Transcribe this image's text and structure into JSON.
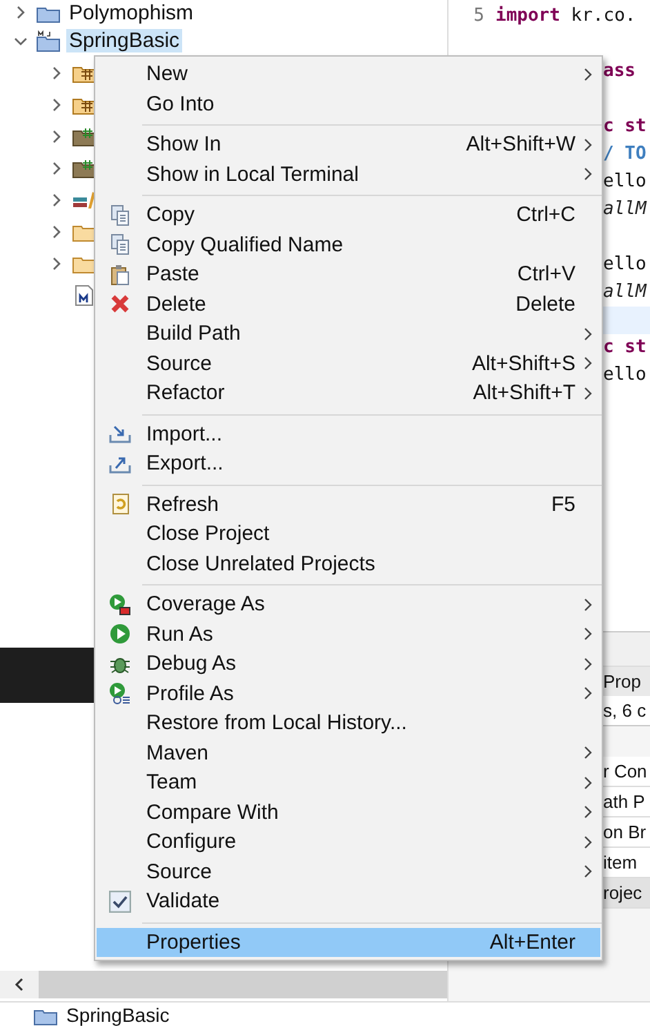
{
  "tree": {
    "items": [
      {
        "label": "Polymophism",
        "kind": "project",
        "expanded": false,
        "selected": false
      },
      {
        "label": "SpringBasic",
        "kind": "maven-project",
        "expanded": true,
        "selected": true,
        "children": [
          {
            "kind": "package-folder",
            "expanded": false
          },
          {
            "kind": "package-folder",
            "expanded": false
          },
          {
            "kind": "source-folder",
            "expanded": false
          },
          {
            "kind": "source-folder",
            "expanded": false
          },
          {
            "kind": "library",
            "expanded": false
          },
          {
            "kind": "folder",
            "expanded": false
          },
          {
            "kind": "folder",
            "expanded": false
          },
          {
            "kind": "file"
          }
        ]
      }
    ]
  },
  "editor": {
    "lines": [
      {
        "number": "5",
        "tokens": [
          {
            "text": "import",
            "kind": "keyword"
          },
          {
            "text": " kr.co.",
            "kind": "plain"
          }
        ]
      },
      {
        "current": false
      },
      {
        "tokens": [
          {
            "text": "ass",
            "kind": "keyword"
          }
        ]
      },
      {
        "current": false
      },
      {
        "tokens": [
          {
            "text": "c st",
            "kind": "keyword"
          }
        ]
      },
      {
        "tokens": [
          {
            "text": "/ TO",
            "kind": "comment"
          }
        ]
      },
      {
        "tokens": [
          {
            "text": "ello",
            "kind": "plain"
          }
        ]
      },
      {
        "tokens": [
          {
            "text": "allM",
            "kind": "italic"
          }
        ]
      },
      {
        "current": false
      },
      {
        "tokens": [
          {
            "text": "ello",
            "kind": "plain"
          }
        ]
      },
      {
        "tokens": [
          {
            "text": "allM",
            "kind": "italic"
          }
        ]
      },
      {
        "current": true
      },
      {
        "tokens": [
          {
            "text": "c st",
            "kind": "keyword"
          }
        ]
      },
      {
        "tokens": [
          {
            "text": "ello",
            "kind": "plain"
          }
        ]
      }
    ]
  },
  "bottom_panel": {
    "tab": "Prop",
    "summary": "s, 6 c",
    "rows": [
      {
        "label": "r Con",
        "selected": false
      },
      {
        "label": "ath P",
        "selected": false
      },
      {
        "label": "on Br",
        "selected": false
      },
      {
        "label": "item",
        "selected": false
      },
      {
        "label": "rojec",
        "selected": true
      }
    ]
  },
  "context_menu": [
    {
      "kind": "item",
      "label": "New",
      "submenu": true,
      "selected": false
    },
    {
      "kind": "item",
      "label": "Go Into",
      "selected": false
    },
    {
      "kind": "separator"
    },
    {
      "kind": "item",
      "label": "Show In",
      "shortcut": "Alt+Shift+W",
      "submenu": true,
      "selected": false
    },
    {
      "kind": "item",
      "label": "Show in Local Terminal",
      "submenu": true,
      "selected": false
    },
    {
      "kind": "separator"
    },
    {
      "kind": "item",
      "label": "Copy",
      "shortcut": "Ctrl+C",
      "selected": false
    },
    {
      "kind": "item",
      "label": "Copy Qualified Name",
      "selected": false
    },
    {
      "kind": "item",
      "label": "Paste",
      "shortcut": "Ctrl+V",
      "selected": false
    },
    {
      "kind": "item",
      "label": "Delete",
      "shortcut": "Delete",
      "selected": false
    },
    {
      "kind": "item",
      "label": "Build Path",
      "submenu": true,
      "selected": false
    },
    {
      "kind": "item",
      "label": "Source",
      "shortcut": "Alt+Shift+S",
      "submenu": true,
      "selected": false
    },
    {
      "kind": "item",
      "label": "Refactor",
      "shortcut": "Alt+Shift+T",
      "submenu": true,
      "selected": false
    },
    {
      "kind": "separator"
    },
    {
      "kind": "item",
      "label": "Import...",
      "selected": false
    },
    {
      "kind": "item",
      "label": "Export...",
      "selected": false
    },
    {
      "kind": "separator"
    },
    {
      "kind": "item",
      "label": "Refresh",
      "shortcut": "F5",
      "selected": false
    },
    {
      "kind": "item",
      "label": "Close Project",
      "selected": false
    },
    {
      "kind": "item",
      "label": "Close Unrelated Projects",
      "selected": false
    },
    {
      "kind": "separator"
    },
    {
      "kind": "item",
      "label": "Coverage As",
      "submenu": true,
      "selected": false
    },
    {
      "kind": "item",
      "label": "Run As",
      "submenu": true,
      "selected": false
    },
    {
      "kind": "item",
      "label": "Debug As",
      "submenu": true,
      "selected": false
    },
    {
      "kind": "item",
      "label": "Profile As",
      "submenu": true,
      "selected": false
    },
    {
      "kind": "item",
      "label": "Restore from Local History...",
      "selected": false
    },
    {
      "kind": "item",
      "label": "Maven",
      "submenu": true,
      "selected": false
    },
    {
      "kind": "item",
      "label": "Team",
      "submenu": true,
      "selected": false
    },
    {
      "kind": "item",
      "label": "Compare With",
      "submenu": true,
      "selected": false
    },
    {
      "kind": "item",
      "label": "Configure",
      "submenu": true,
      "selected": false
    },
    {
      "kind": "item",
      "label": "Source",
      "submenu": true,
      "selected": false
    },
    {
      "kind": "item",
      "label": "Validate",
      "checked": true,
      "selected": false
    },
    {
      "kind": "separator"
    },
    {
      "kind": "item",
      "label": "Properties",
      "shortcut": "Alt+Enter",
      "selected": true
    }
  ],
  "status_bar": {
    "text": "SpringBasic"
  }
}
